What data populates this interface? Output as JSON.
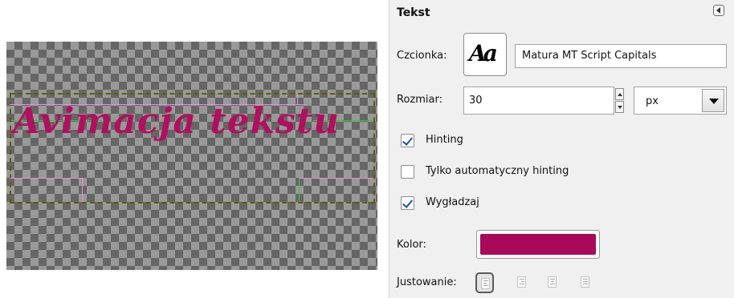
{
  "canvas": {
    "text": "Avimacja tekstu",
    "text_color": "#b0105e"
  },
  "panel": {
    "title": "Tekst",
    "font": {
      "label": "Czcionka:",
      "preview_glyph": "Aa",
      "value": "Matura MT Script Capitals"
    },
    "size": {
      "label": "Rozmiar:",
      "value": "30",
      "unit": "px"
    },
    "checkboxes": [
      {
        "label": "Hinting",
        "checked": true
      },
      {
        "label": "Tylko automatyczny hinting",
        "checked": false
      },
      {
        "label": "Wygładzaj",
        "checked": true
      }
    ],
    "color": {
      "label": "Kolor:",
      "value": "#a8095a"
    },
    "justify": {
      "label": "Justowanie:",
      "options": [
        "justify-left-icon",
        "justify-right-icon",
        "justify-center-icon",
        "justify-fill-icon"
      ],
      "selected": 0
    }
  }
}
